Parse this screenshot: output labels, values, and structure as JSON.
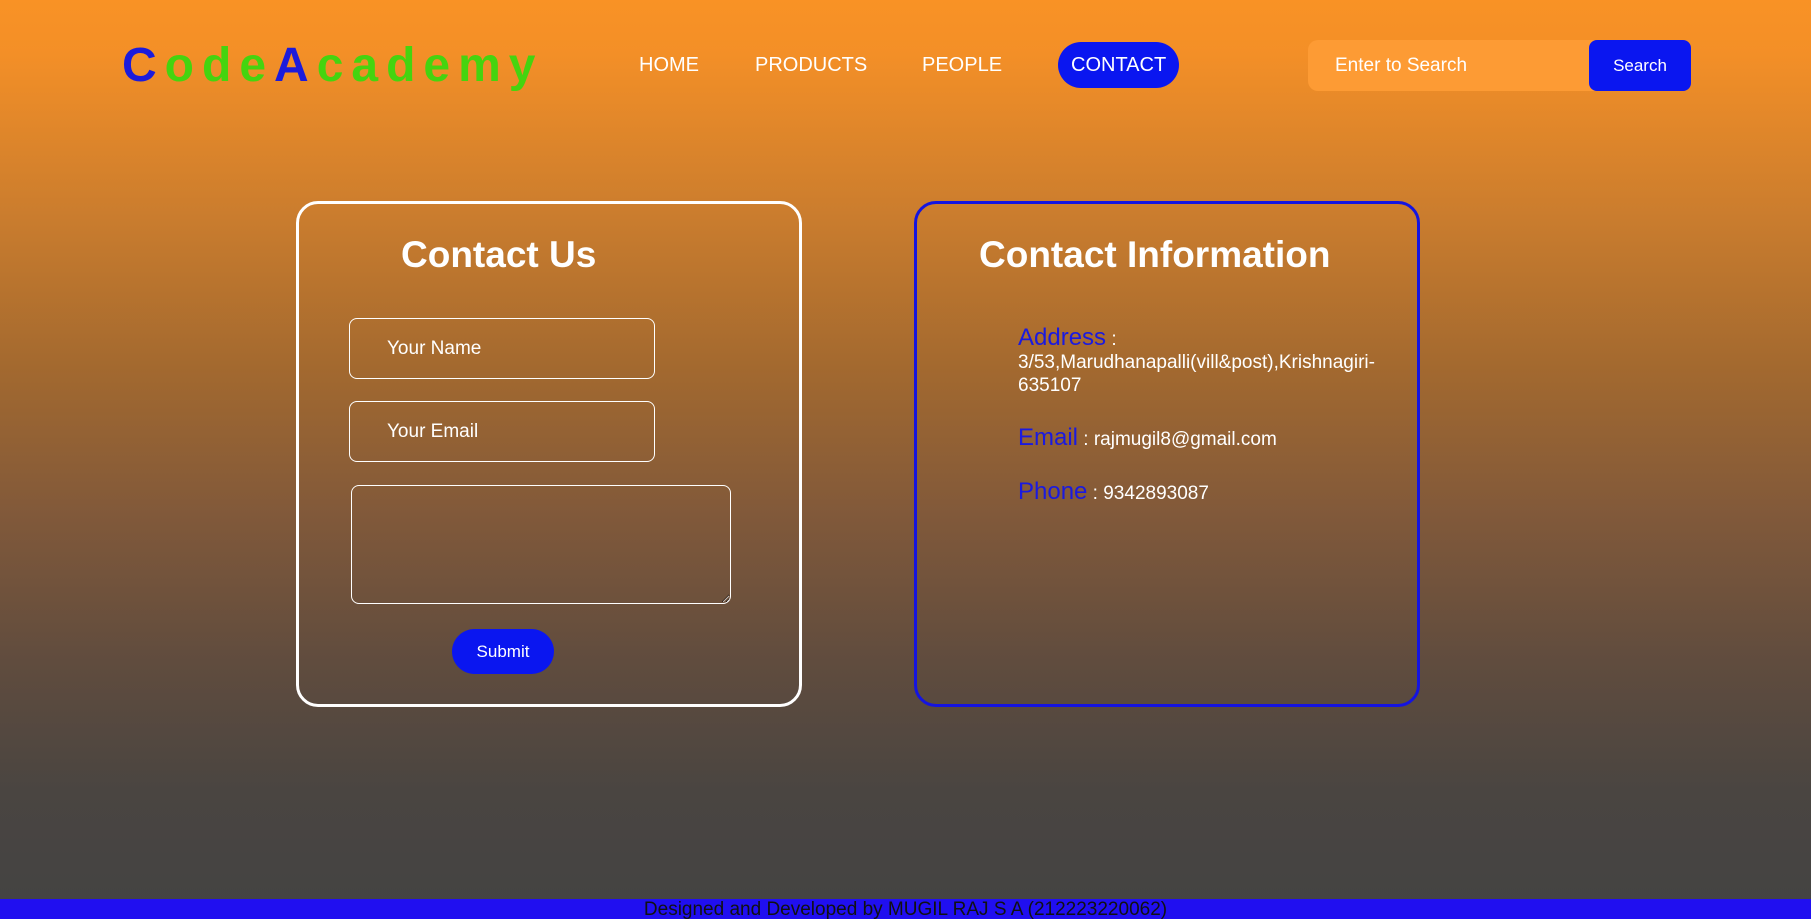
{
  "logo": {
    "part1": "C",
    "part2": "ode",
    "part3": "A",
    "part4": "cademy"
  },
  "nav": {
    "home": "HOME",
    "products": "PRODUCTS",
    "people": "PEOPLE",
    "contact": "CONTACT"
  },
  "search": {
    "placeholder": "Enter to Search",
    "button": "Search"
  },
  "contact_form": {
    "title": "Contact Us",
    "name_placeholder": "Your Name",
    "email_placeholder": "Your Email",
    "message_value": "",
    "submit": "Submit"
  },
  "contact_info": {
    "title": "Contact Information",
    "address_label": "Address",
    "address_value": " : 3/53,Marudhanapalli(vill&post),Krishnagiri-635107",
    "email_label": "Email",
    "email_value": " : rajmugil8@gmail.com",
    "phone_label": "Phone",
    "phone_value": " : 9342893087"
  },
  "footer": {
    "text": "Designed and Developed by MUGIL RAJ S A (212223220062)"
  },
  "colors": {
    "accent_blue": "#0a16f0",
    "logo_blue": "#1b1bdb",
    "logo_green": "#45d40f",
    "bg_top": "#f99225",
    "bg_bottom": "#434343"
  }
}
